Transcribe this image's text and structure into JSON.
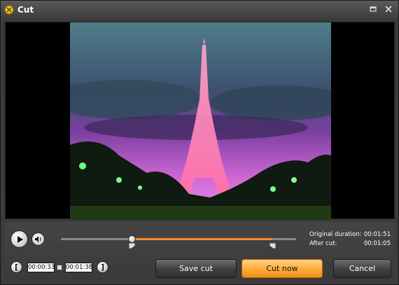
{
  "window": {
    "title": "Cut"
  },
  "playback": {
    "progress_fraction": 0.3,
    "selection_start_fraction": 0.3,
    "selection_end_fraction": 0.9
  },
  "info": {
    "original_label": "Original duration:",
    "original_value": "00:01:51",
    "after_label": "After cut:",
    "after_value": "00:01:05"
  },
  "range": {
    "start": "00:00:33",
    "end": "00:01:38"
  },
  "buttons": {
    "save": "Save cut",
    "cut": "Cut now",
    "cancel": "Cancel"
  },
  "icons": {
    "app": "scissors-icon",
    "restore": "restore-icon",
    "close": "close-icon",
    "play": "play-icon",
    "volume": "volume-icon",
    "mark_in": "bracket-left-icon",
    "mark_out": "bracket-right-icon"
  },
  "colors": {
    "accent": "#ff8a2a",
    "button_orange": "#ffae3c",
    "background": "#3a3a3a"
  }
}
